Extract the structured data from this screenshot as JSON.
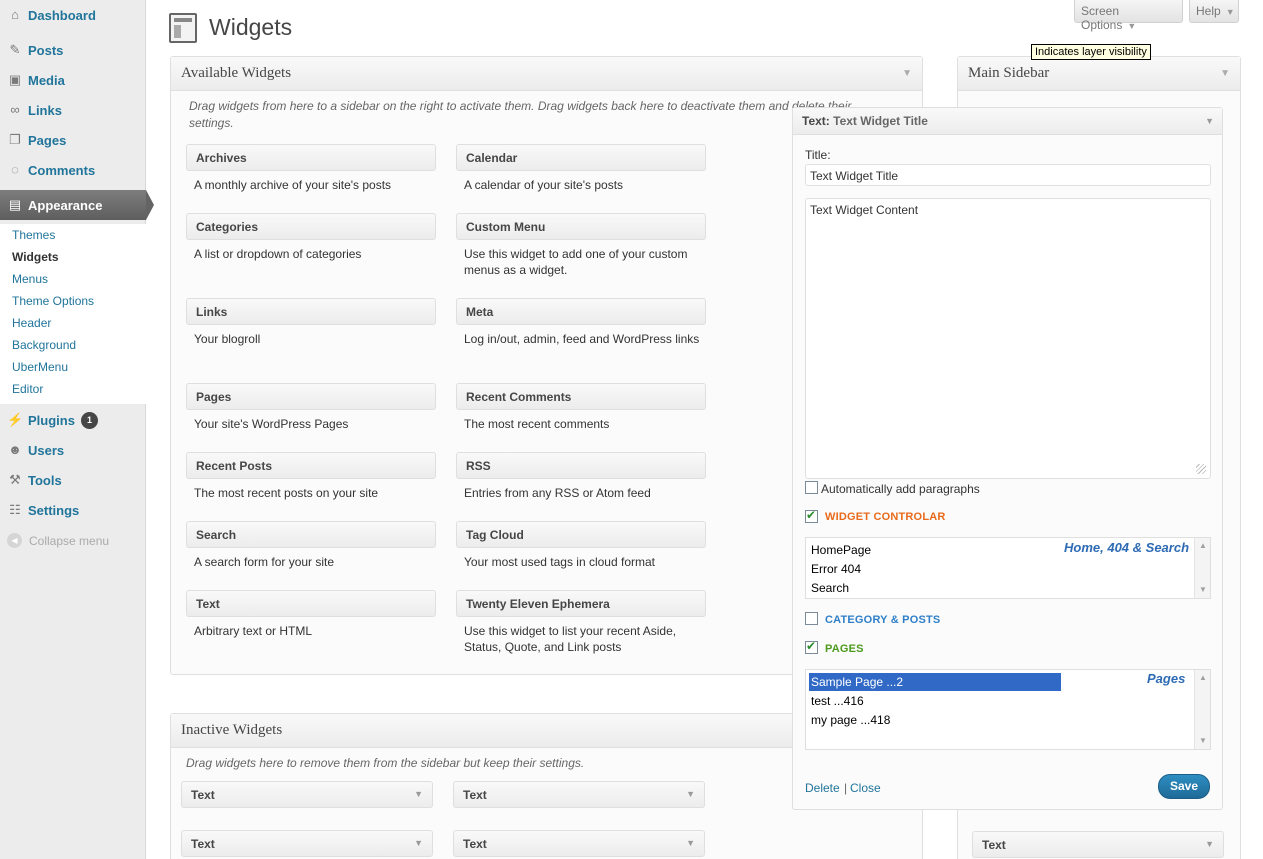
{
  "menu": {
    "top_items": [
      {
        "label": "Dashboard",
        "icon": "dashboard-icon"
      },
      {
        "label": "Posts",
        "icon": "pin-icon"
      },
      {
        "label": "Media",
        "icon": "media-icon"
      },
      {
        "label": "Links",
        "icon": "link-icon"
      },
      {
        "label": "Pages",
        "icon": "page-icon"
      },
      {
        "label": "Comments",
        "icon": "comment-icon"
      },
      {
        "label": "Appearance",
        "icon": "appearance-icon"
      }
    ],
    "submenu": [
      "Themes",
      "Widgets",
      "Menus",
      "Theme Options",
      "Header",
      "Background",
      "UberMenu",
      "Editor"
    ],
    "bottom_items": [
      {
        "label": "Plugins",
        "icon": "plugin-icon",
        "badge": "1"
      },
      {
        "label": "Users",
        "icon": "users-icon"
      },
      {
        "label": "Tools",
        "icon": "tools-icon"
      },
      {
        "label": "Settings",
        "icon": "settings-icon"
      }
    ],
    "collapse": "Collapse menu"
  },
  "header": {
    "title": "Widgets",
    "screen_options": "Screen Options",
    "help": "Help",
    "tooltip": "Indicates layer visibility"
  },
  "available": {
    "title": "Available Widgets",
    "description": "Drag widgets from here to a sidebar on the right to activate them. Drag widgets back here to deactivate them and delete their settings.",
    "widgets": [
      {
        "name": "Archives",
        "desc": "A monthly archive of your site's posts"
      },
      {
        "name": "Calendar",
        "desc": "A calendar of your site's posts"
      },
      {
        "name": "Categories",
        "desc": "A list or dropdown of categories"
      },
      {
        "name": "Custom Menu",
        "desc": "Use this widget to add one of your custom menus as a widget."
      },
      {
        "name": "Links",
        "desc": "Your blogroll"
      },
      {
        "name": "Meta",
        "desc": "Log in/out, admin, feed and WordPress links"
      },
      {
        "name": "Pages",
        "desc": "Your site's WordPress Pages"
      },
      {
        "name": "Recent Comments",
        "desc": "The most recent comments"
      },
      {
        "name": "Recent Posts",
        "desc": "The most recent posts on your site"
      },
      {
        "name": "RSS",
        "desc": "Entries from any RSS or Atom feed"
      },
      {
        "name": "Search",
        "desc": "A search form for your site"
      },
      {
        "name": "Tag Cloud",
        "desc": "Your most used tags in cloud format"
      },
      {
        "name": "Text",
        "desc": "Arbitrary text or HTML"
      },
      {
        "name": "Twenty Eleven Ephemera",
        "desc": "Use this widget to list your recent Aside, Status, Quote, and Link posts"
      }
    ]
  },
  "inactive": {
    "title": "Inactive Widgets",
    "description": "Drag widgets here to remove them from the sidebar but keep their settings.",
    "widgets": [
      "Text",
      "Text",
      "Text",
      "Text"
    ]
  },
  "sidebar": {
    "title": "Main Sidebar",
    "bottom_widget": "Text"
  },
  "editor": {
    "head_prefix": "Text:",
    "head_title": "Text Widget Title",
    "title_label": "Title:",
    "title_value": "Text Widget Title",
    "content_value": "Text Widget Content",
    "auto_paragraphs": "Automatically add paragraphs",
    "auto_paragraphs_checked": false,
    "widget_controlar": {
      "label": "WIDGET CONTROLAR",
      "checked": true,
      "color": "#e86a1a",
      "list_title": "Home, 404 & Search",
      "options": [
        "HomePage",
        "Error 404",
        "Search"
      ]
    },
    "category_posts": {
      "label": "CATEGORY & POSTS",
      "checked": false,
      "color": "#2e7fc8"
    },
    "pages": {
      "label": "PAGES",
      "checked": true,
      "color": "#4d9a1e",
      "list_title": "Pages",
      "options": [
        "Sample Page ...2",
        "test ...416",
        "my page ...418"
      ],
      "selected": 0
    },
    "delete": "Delete",
    "separator": "|",
    "close": "Close",
    "save": "Save"
  }
}
